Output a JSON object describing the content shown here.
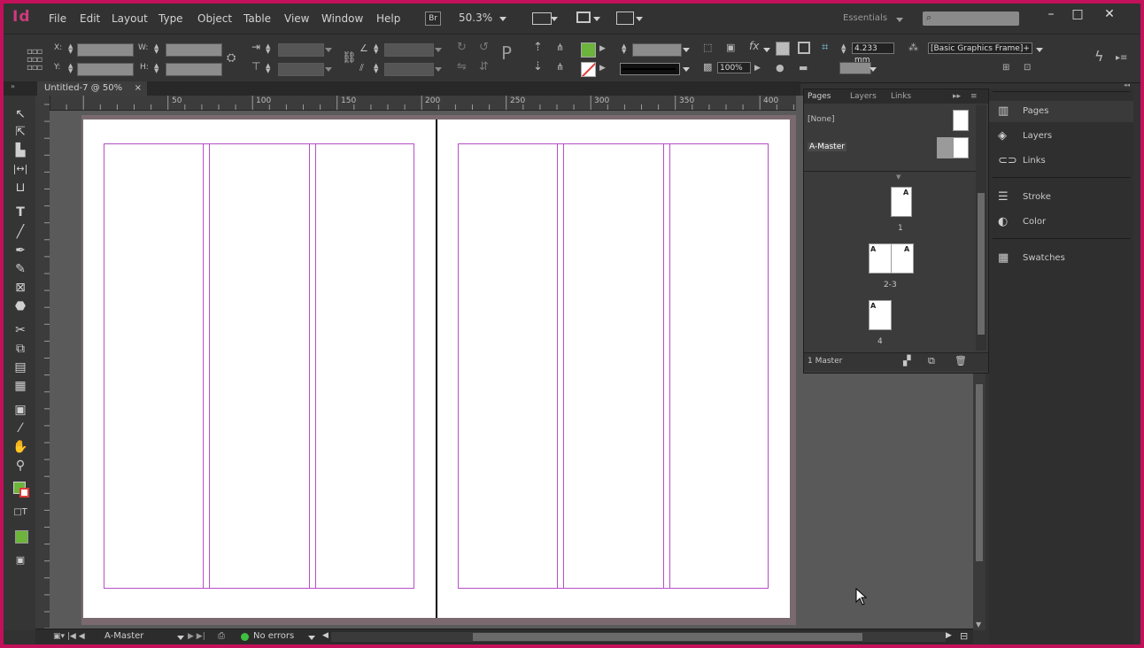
{
  "app": {
    "logo": "Id",
    "menus": [
      "File",
      "Edit",
      "Layout",
      "Type",
      "Object",
      "Table",
      "View",
      "Window",
      "Help"
    ],
    "bridge_label": "Br",
    "zoom_value": "50.3%",
    "workspace": "Essentials",
    "search_placeholder": "",
    "window_controls": [
      "–",
      "□",
      "✕"
    ]
  },
  "control_bar": {
    "x_label": "X:",
    "y_label": "Y:",
    "w_label": "W:",
    "h_label": "H:",
    "stroke_weight": "4.233 mm",
    "opacity": "100%",
    "object_style": "[Basic Graphics Frame]+",
    "fill_color": "#6cb43c",
    "stroke_color": "#e23a3a"
  },
  "document": {
    "tab_title": "Untitled-7 @ 50%",
    "tab_close": "×",
    "ruler_labels": [
      "50",
      "100",
      "150",
      "200",
      "250",
      "300",
      "350",
      "400"
    ]
  },
  "pages_panel": {
    "tabs": [
      "Pages",
      "Layers",
      "Links"
    ],
    "masters": [
      {
        "label": "[None]"
      },
      {
        "label": "A-Master"
      }
    ],
    "pages": [
      {
        "number": "1",
        "master_letter": "A"
      },
      {
        "number": "2-3",
        "master_letter": "A"
      },
      {
        "number": "4",
        "master_letter": "A"
      }
    ],
    "footer_label": "1 Master"
  },
  "dock": {
    "items": [
      {
        "label": "Pages",
        "icon": "pages-icon"
      },
      {
        "label": "Layers",
        "icon": "layers-icon"
      },
      {
        "label": "Links",
        "icon": "links-icon"
      },
      {
        "label": "Stroke",
        "icon": "stroke-icon"
      },
      {
        "label": "Color",
        "icon": "color-icon"
      },
      {
        "label": "Swatches",
        "icon": "swatches-icon"
      }
    ]
  },
  "status": {
    "page_field": "A-Master",
    "preflight": "No errors",
    "preflight_color": "#3fbf3f"
  },
  "colors": {
    "frame": "#c3105a",
    "guide": "#b74ec7",
    "ui_bg": "#323232",
    "pasteboard": "#5a5a5a"
  }
}
